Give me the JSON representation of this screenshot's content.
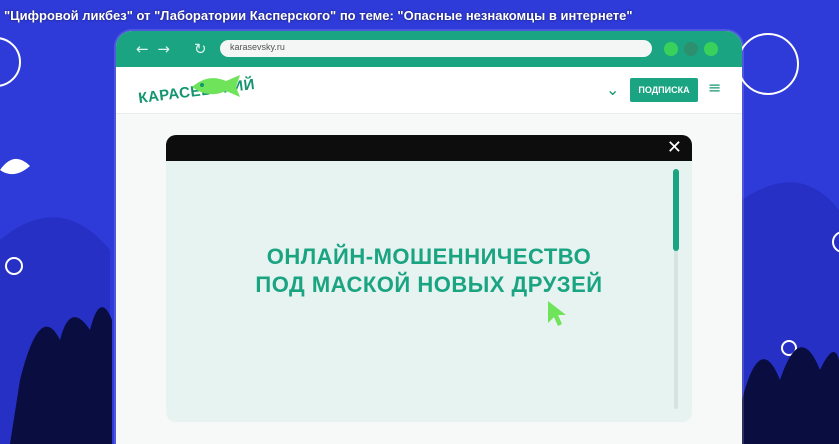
{
  "video": {
    "title": "\"Цифровой ликбез\" от \"Лаборатории Касперского\" по теме: \"Опасные незнакомцы в интернете\""
  },
  "browser": {
    "back_icon": "arrow-left-icon",
    "forward_icon": "arrow-right-icon",
    "reload_icon": "reload-icon",
    "nav_arrows_glyph": "← →",
    "reload_glyph": "↻",
    "url": "karasevsky.ru",
    "window_dots": [
      "#39d15c",
      "#2e8f6f",
      "#39d15c"
    ]
  },
  "site": {
    "logo_text": "КАРАСЕВСКИЙ",
    "logo_icon": "fish-icon",
    "dropdown_icon": "chevron-down-icon",
    "chevron_glyph": "⌄",
    "subscribe_label": "ПОДПИСКА",
    "menu_icon": "hamburger-menu-icon",
    "menu_glyph": "≡"
  },
  "modal": {
    "close_glyph": "✕",
    "headline_line1": "ОНЛАЙН-МОШЕННИЧЕСТВО",
    "headline_line2": "ПОД МАСКОЙ НОВЫХ ДРУЗЕЙ",
    "cursor_icon": "cursor-arrow-icon"
  },
  "colors": {
    "background": "#2f3bd9",
    "accent_green": "#1aa482",
    "cursor_green": "#6fe35a",
    "modal_bg": "#e6f3f1"
  }
}
